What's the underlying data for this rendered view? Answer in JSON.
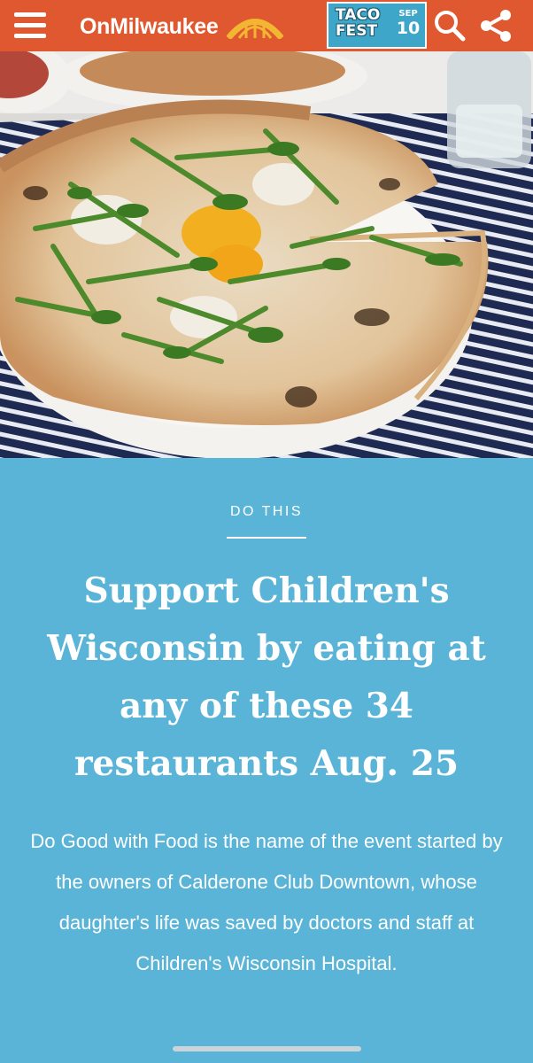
{
  "header": {
    "brand": "OnMilwaukee",
    "promo": {
      "line1": "TACO",
      "line2": "FEST",
      "month": "SEP",
      "day": "10"
    },
    "icons": [
      "hamburger-menu-icon",
      "arch-logo-icon",
      "search-icon",
      "share-icon"
    ]
  },
  "hero": {
    "image": "pizza-with-arugula-and-egg-photo"
  },
  "article": {
    "category": "DO THIS",
    "headline": "Support Children's Wisconsin by eating at any of these 34 restaurants Aug. 25",
    "dek": "Do Good with Food is the name of the event started by the owners of Calderone Club Downtown, whose daughter's life was saved by doctors and staff at Children's Wisconsin Hospital."
  },
  "colors": {
    "header_bg": "#e0582f",
    "article_bg": "#5ab4d7",
    "promo_bg": "#3ea6c8",
    "logo_arch": "#f2b632"
  }
}
